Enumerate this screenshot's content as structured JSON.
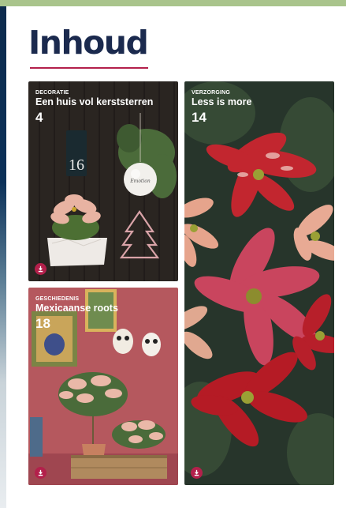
{
  "page": {
    "title": "Inhoud"
  },
  "colors": {
    "navy": "#1b2a4e",
    "accent": "#b3204b",
    "top_bar": "#a9c48c"
  },
  "cards": [
    {
      "category": "DECORATIE",
      "title": "Een huis vol kerststerren",
      "page": "4",
      "action_icon": "download-icon"
    },
    {
      "category": "GESCHIEDENIS",
      "title": "Mexicaanse roots",
      "page": "18",
      "action_icon": "download-icon"
    },
    {
      "category": "VERZORGING",
      "title": "Less is more",
      "page": "14",
      "action_icon": "download-icon"
    }
  ],
  "photo_text": {
    "house_number": "16",
    "ornament_script": "Emotion"
  }
}
